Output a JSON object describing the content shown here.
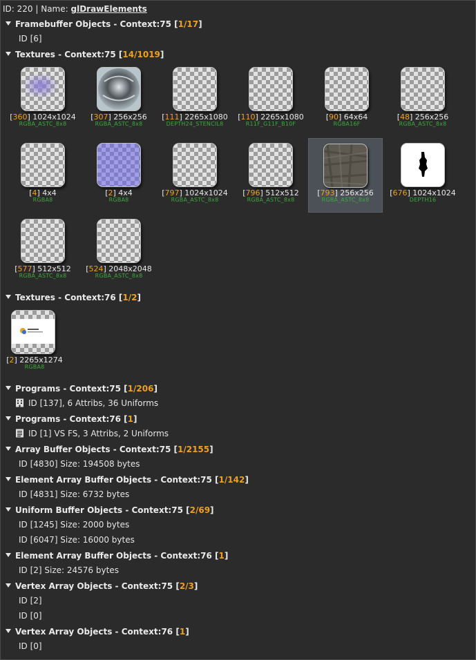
{
  "header": {
    "prefix": "ID: 220 | Name: ",
    "name": "glDrawElements"
  },
  "sections": [
    {
      "title": "Framebuffer Objects - Context:75",
      "count": "1/17"
    },
    {
      "title": "Textures - Context:75",
      "count": "14/1019"
    },
    {
      "title": "Textures - Context:76",
      "count": "1/2"
    },
    {
      "title": "Programs - Context:75",
      "count": "1/206"
    },
    {
      "title": "Programs - Context:76",
      "count": "1"
    },
    {
      "title": "Array Buffer Objects - Context:75",
      "count": "1/2155"
    },
    {
      "title": "Element Array Buffer Objects - Context:75",
      "count": "1/142"
    },
    {
      "title": "Uniform Buffer Objects - Context:75",
      "count": "2/69"
    },
    {
      "title": "Element Array Buffer Objects - Context:76",
      "count": "1"
    },
    {
      "title": "Vertex Array Objects - Context:75",
      "count": "2/3"
    },
    {
      "title": "Vertex Array Objects - Context:76",
      "count": "1"
    }
  ],
  "items": {
    "fbo_75": [
      "ID [6]"
    ],
    "prog_75": [
      "ID [137], 6 Attribs, 36 Uniforms"
    ],
    "prog_76": [
      "ID [1] VS FS, 3 Attribs, 2 Uniforms"
    ],
    "abo_75": [
      "ID [4830] Size: 194508 bytes"
    ],
    "eabo_75": [
      "ID [4831] Size: 6732 bytes"
    ],
    "ubo_75": [
      "ID [1245] Size: 2000 bytes",
      "ID [6047] Size: 16000 bytes"
    ],
    "eabo_76": [
      "ID [2] Size: 24576 bytes"
    ],
    "vao_75": [
      "ID [2]",
      "ID [0]"
    ],
    "vao_76": [
      "ID [0]"
    ]
  },
  "textures_75": [
    {
      "id": "360",
      "size": "1024x1024",
      "format": "RGBA_ASTC_8x8"
    },
    {
      "id": "307",
      "size": "256x256",
      "format": "RGBA_ASTC_8x8"
    },
    {
      "id": "111",
      "size": "2265x1080",
      "format": "DEPTH24_STENCIL8"
    },
    {
      "id": "110",
      "size": "2265x1080",
      "format": "R11F_G11F_B10F"
    },
    {
      "id": "90",
      "size": "64x64",
      "format": "RGBA16F"
    },
    {
      "id": "48",
      "size": "256x256",
      "format": "RGBA_ASTC_8x8"
    },
    {
      "id": "4",
      "size": "4x4",
      "format": "RGBA8"
    },
    {
      "id": "2",
      "size": "4x4",
      "format": "RGBA8"
    },
    {
      "id": "797",
      "size": "1024x1024",
      "format": "RGBA_ASTC_8x8"
    },
    {
      "id": "796",
      "size": "512x512",
      "format": "RGBA_ASTC_8x8"
    },
    {
      "id": "793",
      "size": "256x256",
      "format": "RGBA_ASTC_8x8"
    },
    {
      "id": "676",
      "size": "1024x1024",
      "format": "DEPTH16"
    },
    {
      "id": "577",
      "size": "512x512",
      "format": "RGBA_ASTC_8x8"
    },
    {
      "id": "524",
      "size": "2048x2048",
      "format": "RGBA_ASTC_8x8"
    }
  ],
  "textures_76": [
    {
      "id": "2",
      "size": "2265x1274",
      "format": "RGBA8"
    }
  ],
  "colors": {
    "accent_count": "#f0a020",
    "format_green": "#3ea83e",
    "selected_tile": "#4c5157"
  }
}
